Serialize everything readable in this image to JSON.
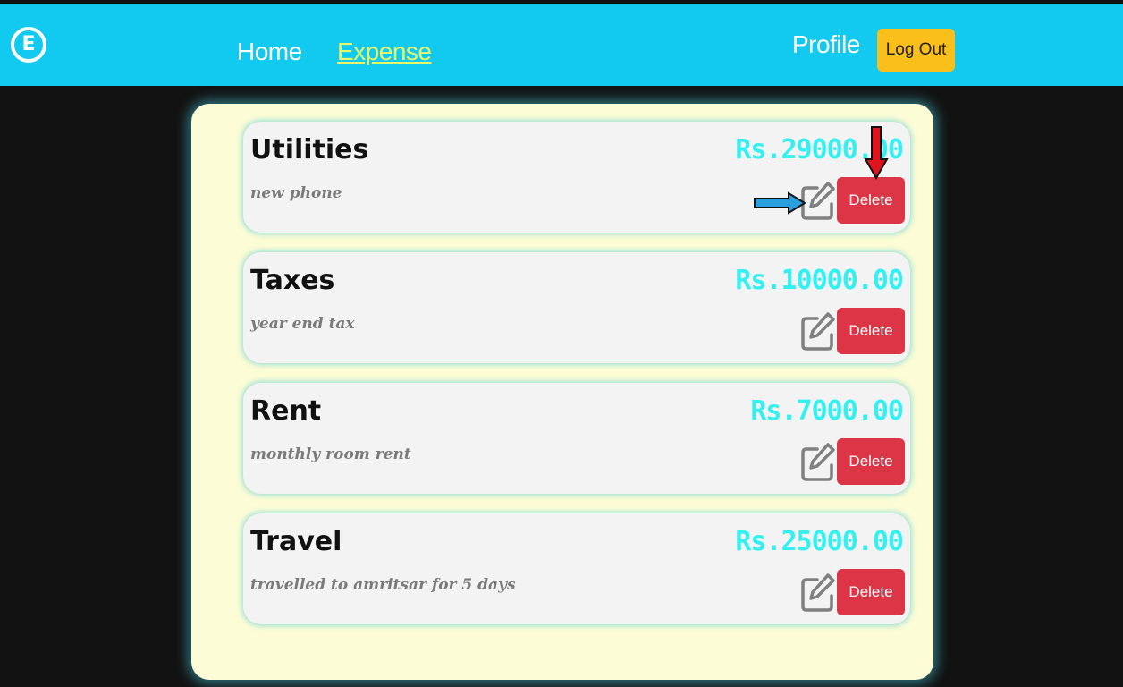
{
  "nav": {
    "brand_letter": "E",
    "home": "Home",
    "expense": "Expense",
    "profile": "Profile",
    "logout": "Log Out"
  },
  "colors": {
    "navbar": "#12c9ef",
    "active_link": "#e6f56a",
    "logout": "#fbbf1c",
    "delete": "#dc3545",
    "amount": "#35f0f0",
    "panel": "#fcfcd6"
  },
  "expenses": [
    {
      "category": "Utilities",
      "description": "new phone",
      "amount": "Rs.29000.00",
      "delete_label": "Delete",
      "edit_icon": "pencil-square-icon"
    },
    {
      "category": "Taxes",
      "description": "year end tax",
      "amount": "Rs.10000.00",
      "delete_label": "Delete",
      "edit_icon": "pencil-square-icon"
    },
    {
      "category": "Rent",
      "description": "monthly room rent",
      "amount": "Rs.7000.00",
      "delete_label": "Delete",
      "edit_icon": "pencil-square-icon"
    },
    {
      "category": "Travel",
      "description": "travelled to amritsar for 5 days",
      "amount": "Rs.25000.00",
      "delete_label": "Delete",
      "edit_icon": "pencil-square-icon"
    }
  ],
  "annotations": {
    "arrow_down_color": "#e0141e",
    "arrow_right_color": "#2a9fe0"
  }
}
